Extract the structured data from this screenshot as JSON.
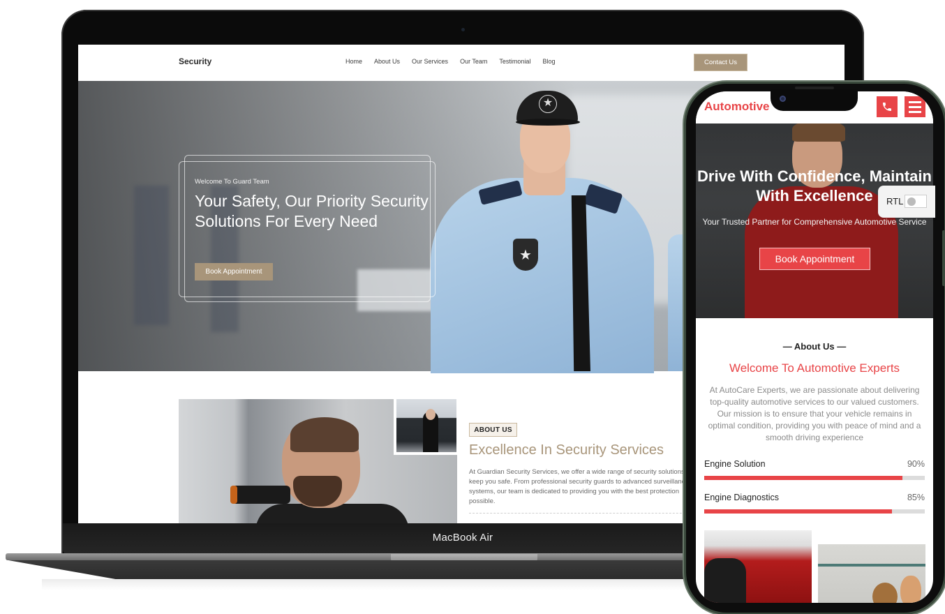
{
  "laptop": {
    "brand_label": "MacBook Air",
    "site": {
      "logo": "Security",
      "nav": [
        "Home",
        "About Us",
        "Our Services",
        "Our Team",
        "Testimonial",
        "Blog"
      ],
      "contact_button": "Contact Us",
      "hero": {
        "subtitle": "Welcome To Guard Team",
        "title": "Your Safety, Our Priority Security Solutions For Every Need",
        "button": "Book Appointment"
      },
      "about": {
        "tag": "ABOUT US",
        "title": "Excellence In Security Services",
        "text": "At Guardian Security Services, we offer a wide range of security solutions to keep you safe. From professional security guards to advanced surveillance systems, our team is dedicated to providing you with the best protection possible."
      },
      "accent_color": "#a8957a"
    }
  },
  "phone": {
    "site": {
      "logo": "Automotive",
      "call_icon": "phone-icon",
      "menu_icon": "hamburger-menu-icon",
      "hero": {
        "title": "Drive With Confidence, Maintain With Excellence",
        "subtitle": "Your Trusted Partner for Comprehensive Automotive Service",
        "button": "Book Appointment"
      },
      "rtl_toggle": {
        "label": "RTL",
        "enabled": false
      },
      "about": {
        "label": "— About Us —",
        "title": "Welcome To Automotive Experts",
        "text": "At AutoCare Experts, we are passionate about delivering top-quality automotive services to our valued customers. Our mission is to ensure that your vehicle remains in optimal condition, providing you with peace of mind and a smooth driving experience"
      },
      "skills": [
        {
          "name": "Engine Solution",
          "percent_label": "90%",
          "value": 90
        },
        {
          "name": "Engine Diagnostics",
          "percent_label": "85%",
          "value": 85
        }
      ],
      "accent_color": "#e84447"
    }
  }
}
